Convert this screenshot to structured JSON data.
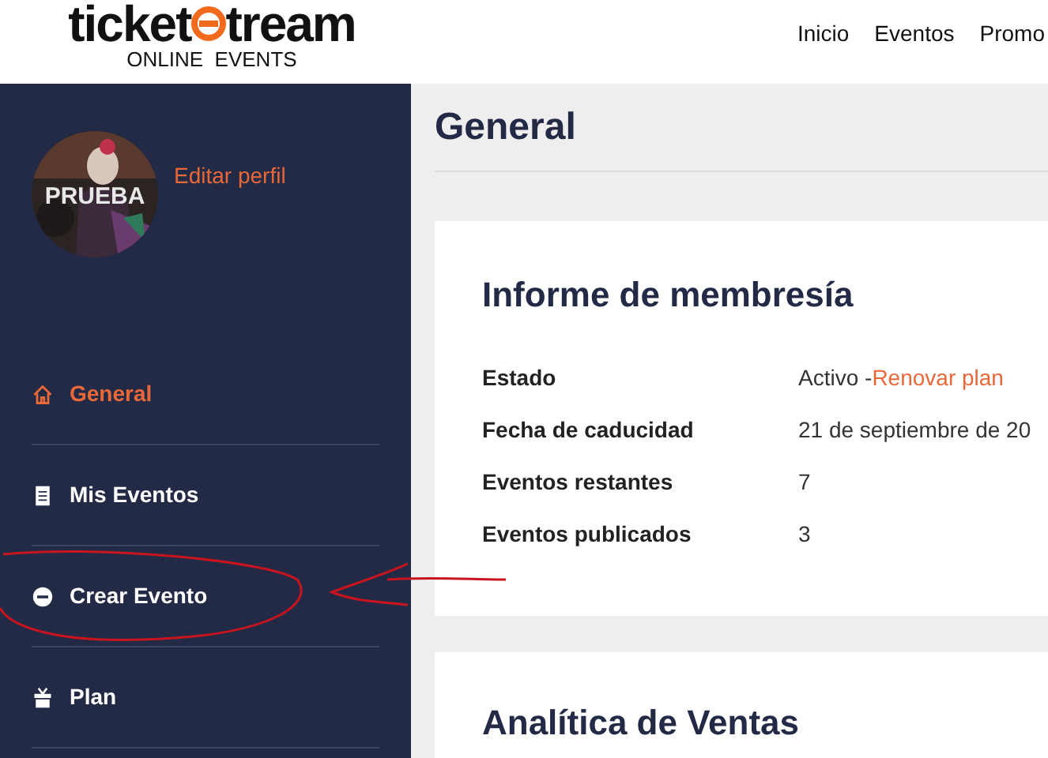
{
  "header": {
    "logo": {
      "left": "ticket",
      "right": "tream",
      "tagline": "ONLINE  EVENTS"
    },
    "nav": [
      {
        "label": "Inicio"
      },
      {
        "label": "Eventos"
      },
      {
        "label": "Promo"
      }
    ]
  },
  "sidebar": {
    "profile": {
      "avatar_label": "PRUEBA",
      "edit_link": "Editar perfil"
    },
    "items": [
      {
        "label": "General",
        "kind": "home",
        "selected": true
      },
      {
        "label": "Mis Eventos",
        "kind": "document",
        "selected": false
      },
      {
        "label": "Crear Evento",
        "kind": "plus",
        "selected": false
      },
      {
        "label": "Plan",
        "kind": "gift",
        "selected": false
      }
    ]
  },
  "page_title": "General",
  "membership": {
    "title": "Informe de membresía",
    "rows": [
      {
        "label": "Estado",
        "value": "Activo - ",
        "link": "Renovar plan"
      },
      {
        "label": "Fecha de caducidad",
        "value": "21 de septiembre de 20"
      },
      {
        "label": "Eventos restantes",
        "value": "7"
      },
      {
        "label": "Eventos publicados",
        "value": "3"
      }
    ]
  },
  "analytics": {
    "title": "Analítica de Ventas"
  }
}
